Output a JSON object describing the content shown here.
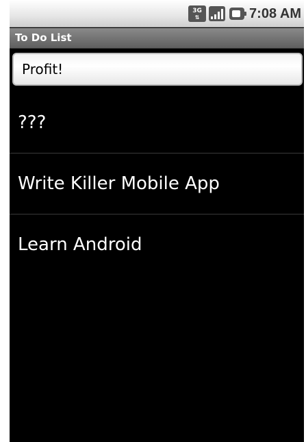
{
  "status_bar": {
    "network_label": "3G",
    "network_icon": "3g-data-icon",
    "signal_icon": "signal-strength-icon",
    "battery_icon": "battery-icon",
    "time": "7:08 AM"
  },
  "app": {
    "title": "To Do List"
  },
  "input": {
    "value": "Profit!"
  },
  "items": [
    {
      "label": "???"
    },
    {
      "label": "Write Killer Mobile App"
    },
    {
      "label": "Learn Android"
    }
  ],
  "colors": {
    "background": "#000000",
    "item_text": "#ffffff",
    "title_bar": "#6e6e6e"
  }
}
